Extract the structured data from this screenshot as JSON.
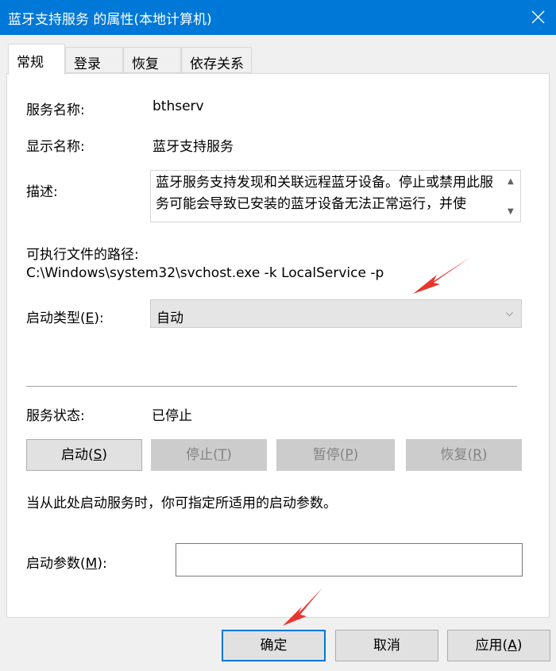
{
  "window": {
    "title": "蓝牙支持服务 的属性(本地计算机)",
    "close_icon": "close-icon"
  },
  "tabs": [
    {
      "label": "常规",
      "active": true
    },
    {
      "label": "登录"
    },
    {
      "label": "恢复"
    },
    {
      "label": "依存关系"
    }
  ],
  "general": {
    "service_name_label": "服务名称:",
    "service_name": "bthserv",
    "display_name_label": "显示名称:",
    "display_name": "蓝牙支持服务",
    "description_label": "描述:",
    "description": "蓝牙服务支持发现和关联远程蓝牙设备。停止或禁用此服务可能会导致已安装的蓝牙设备无法正常运行，并使",
    "path_label": "可执行文件的路径:",
    "path": "C:\\Windows\\system32\\svchost.exe -k LocalService -p",
    "startup_type_label": "启动类型(",
    "startup_type_key": "E",
    "startup_type_suffix": "):",
    "startup_type_value": "自动",
    "status_label": "服务状态:",
    "status_value": "已停止",
    "buttons": {
      "start": {
        "text": "启动(",
        "key": "S",
        "suffix": ")"
      },
      "stop": {
        "text": "停止(",
        "key": "T",
        "suffix": ")"
      },
      "pause": {
        "text": "暂停(",
        "key": "P",
        "suffix": ")"
      },
      "resume": {
        "text": "恢复(",
        "key": "R",
        "suffix": ")"
      }
    },
    "hint": "当从此处启动服务时，你可指定所适用的启动参数。",
    "params_label": "启动参数(",
    "params_key": "M",
    "params_suffix": "):",
    "params_value": ""
  },
  "footer": {
    "ok": "确定",
    "cancel": "取消",
    "apply": {
      "text": "应用(",
      "key": "A",
      "suffix": ")"
    }
  },
  "colors": {
    "titlebar": "#0078d7",
    "annotation_arrow": "#e8352c"
  }
}
